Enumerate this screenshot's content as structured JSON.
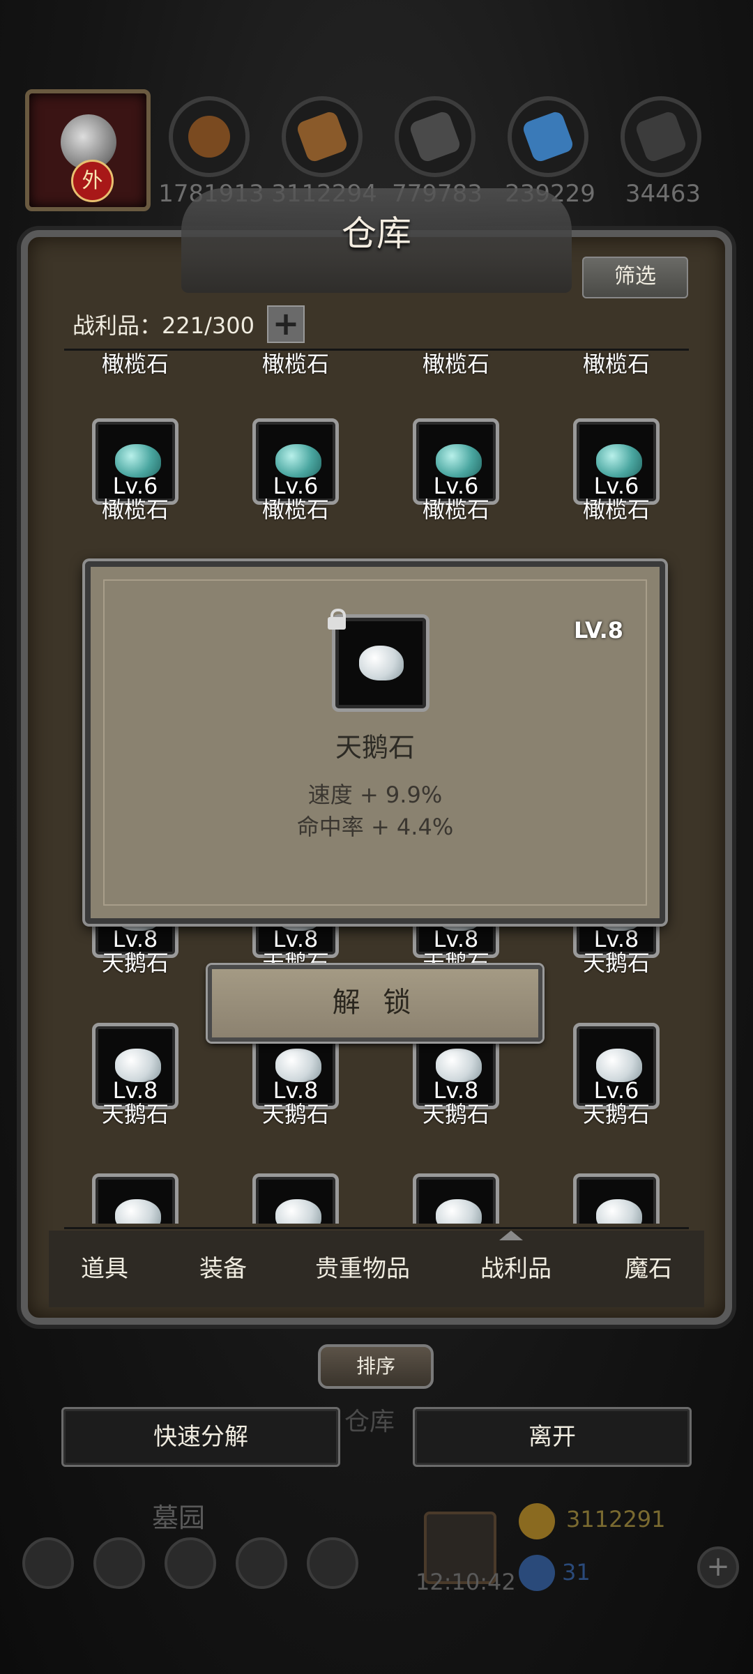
{
  "resources": [
    {
      "icon": "bread-icon",
      "value": "1781913",
      "color": "#7a4a20"
    },
    {
      "icon": "wood-icon",
      "value": "3112294",
      "color": "#8a5a2a"
    },
    {
      "icon": "stone-icon",
      "value": "779783",
      "color": "#4a4a4a"
    },
    {
      "icon": "crystal-icon",
      "value": "239229",
      "color": "#3a7ab8"
    },
    {
      "icon": "iron-icon",
      "value": "34463",
      "color": "#3c3c3c"
    }
  ],
  "portrait_badge": "外",
  "warehouse": {
    "title": "仓库",
    "filter_label": "筛选",
    "count_label": "战利品：221/300",
    "plus_label": "+"
  },
  "items": {
    "row0_name": "橄榄石",
    "row1": [
      {
        "level": "Lv.6",
        "name": "橄榄石",
        "type": "olive"
      },
      {
        "level": "Lv.6",
        "name": "橄榄石",
        "type": "olive"
      },
      {
        "level": "Lv.6",
        "name": "橄榄石",
        "type": "olive"
      },
      {
        "level": "Lv.6",
        "name": "橄榄石",
        "type": "olive"
      }
    ],
    "row2": [
      {
        "level": "Lv.8",
        "name": "天鹅石",
        "type": "swan"
      },
      {
        "level": "Lv.8",
        "name": "天鹅石",
        "type": "swan"
      },
      {
        "level": "Lv.8",
        "name": "天鹅石",
        "type": "swan"
      },
      {
        "level": "Lv.8",
        "name": "天鹅石",
        "type": "swan"
      }
    ],
    "row3": [
      {
        "level": "Lv.8",
        "name": "天鹅石",
        "type": "swan"
      },
      {
        "level": "Lv.8",
        "name": "天鹅石",
        "type": "swan"
      },
      {
        "level": "Lv.8",
        "name": "天鹅石",
        "type": "swan"
      },
      {
        "level": "Lv.6",
        "name": "天鹅石",
        "type": "swan"
      }
    ]
  },
  "tooltip": {
    "level": "LV.8",
    "name": "天鹅石",
    "stat1": "速度 + 9.9%",
    "stat2": "命中率 + 4.4%",
    "unlock_label": "解 锁"
  },
  "tabs": [
    "道具",
    "装备",
    "贵重物品",
    "战利品",
    "魔石"
  ],
  "active_tab": "战利品",
  "sort_label": "排序",
  "background_label": "仓库",
  "quick_decompose_label": "快速分解",
  "leave_label": "离开",
  "bottom_hud": {
    "area_label": "墓园",
    "time": "12:10:42",
    "gold": "3112291",
    "gems": "31",
    "plus": "+"
  }
}
